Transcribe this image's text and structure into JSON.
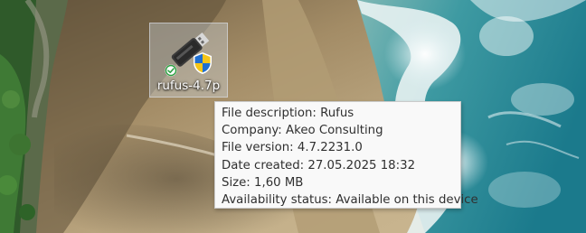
{
  "desktop": {
    "icon": {
      "label": "rufus-4.7p",
      "icon_name": "usb-drive-icon",
      "overlays": [
        "sync-check-icon",
        "uac-shield-icon"
      ],
      "selected": true
    }
  },
  "tooltip": {
    "lines": [
      "File description: Rufus",
      "Company: Akeo Consulting",
      "File version: 4.7.2231.0",
      "Date created: 27.05.2025 18:32",
      "Size: 1,60 MB",
      "Availability status: Available on this device"
    ]
  },
  "colors": {
    "status_check": "#2ea043",
    "shield_blue": "#1f6fd1",
    "shield_yellow": "#f5c518",
    "tooltip_bg": "#f9f9f9",
    "tooltip_text": "#303030"
  }
}
